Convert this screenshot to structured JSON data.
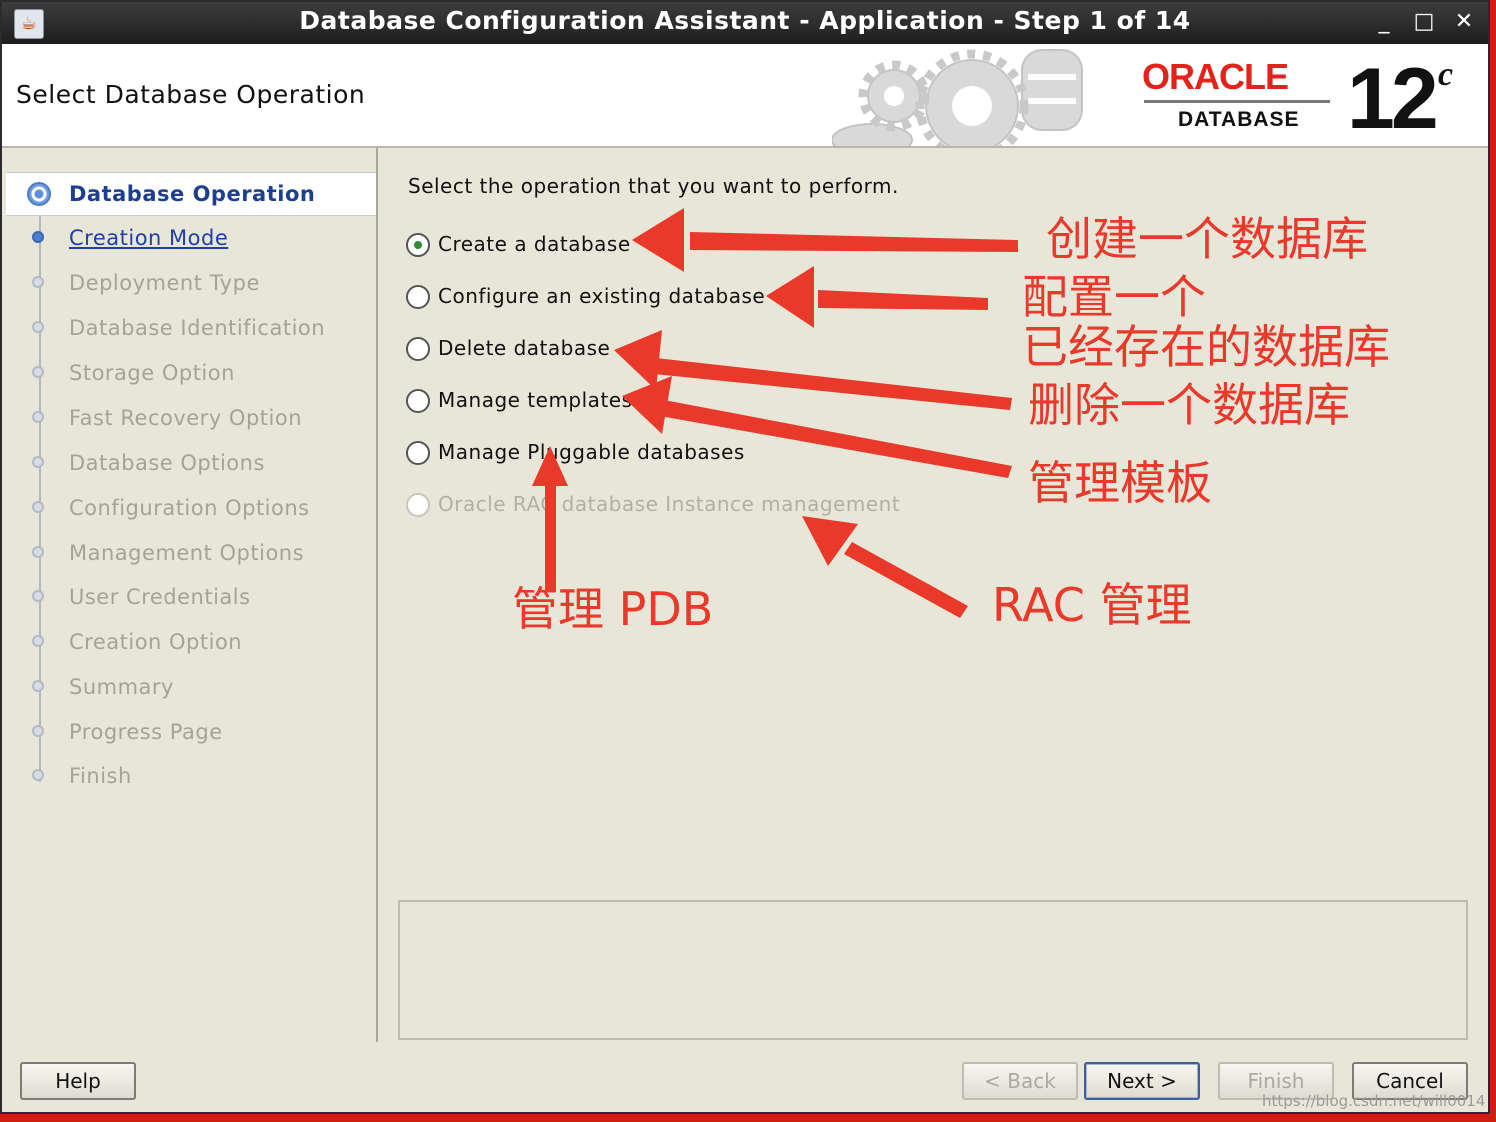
{
  "window": {
    "title": "Database Configuration Assistant - Application - Step 1 of 14",
    "app_icon": "java-icon",
    "controls": {
      "minimize": "_",
      "maximize": "□",
      "close": "✕"
    }
  },
  "header": {
    "title": "Select Database Operation",
    "brand": {
      "name": "ORACLE",
      "product": "DATABASE",
      "version": "12",
      "version_suffix": "c"
    }
  },
  "steps": [
    {
      "label": "Database Operation",
      "state": "active"
    },
    {
      "label": "Creation Mode",
      "state": "link"
    },
    {
      "label": "Deployment Type",
      "state": "disabled"
    },
    {
      "label": "Database Identification",
      "state": "disabled"
    },
    {
      "label": "Storage Option",
      "state": "disabled"
    },
    {
      "label": "Fast Recovery Option",
      "state": "disabled"
    },
    {
      "label": "Database Options",
      "state": "disabled"
    },
    {
      "label": "Configuration Options",
      "state": "disabled"
    },
    {
      "label": "Management Options",
      "state": "disabled"
    },
    {
      "label": "User Credentials",
      "state": "disabled"
    },
    {
      "label": "Creation Option",
      "state": "disabled"
    },
    {
      "label": "Summary",
      "state": "disabled"
    },
    {
      "label": "Progress Page",
      "state": "disabled"
    },
    {
      "label": "Finish",
      "state": "disabled"
    }
  ],
  "main": {
    "prompt": "Select the operation that you want to perform.",
    "options": [
      {
        "label": "Create a database",
        "checked": true,
        "enabled": true
      },
      {
        "label": "Configure an existing database",
        "checked": false,
        "enabled": true
      },
      {
        "label": "Delete database",
        "checked": false,
        "enabled": true
      },
      {
        "label": "Manage templates",
        "checked": false,
        "enabled": true
      },
      {
        "label": "Manage Pluggable databases",
        "checked": false,
        "enabled": true
      },
      {
        "label": "Oracle RAC database Instance management",
        "checked": false,
        "enabled": false
      }
    ],
    "message": ""
  },
  "footer": {
    "help": "Help",
    "back": "< Back",
    "next": "Next >",
    "finish": "Finish",
    "cancel": "Cancel"
  },
  "annotations": {
    "create": "创建一个数据库",
    "configure_1": "配置一个",
    "configure_2": "已经存在的数据库",
    "delete": "删除一个数据库",
    "templates": "管理模板",
    "pdb": "管理 PDB",
    "rac": "RAC 管理"
  },
  "watermark": "https://blog.csdn.net/will0014",
  "colors": {
    "annotation": "#e8392a",
    "link": "#1e3fa6",
    "active_step": "#1d3f8f",
    "oracle_red": "#e2231a"
  }
}
